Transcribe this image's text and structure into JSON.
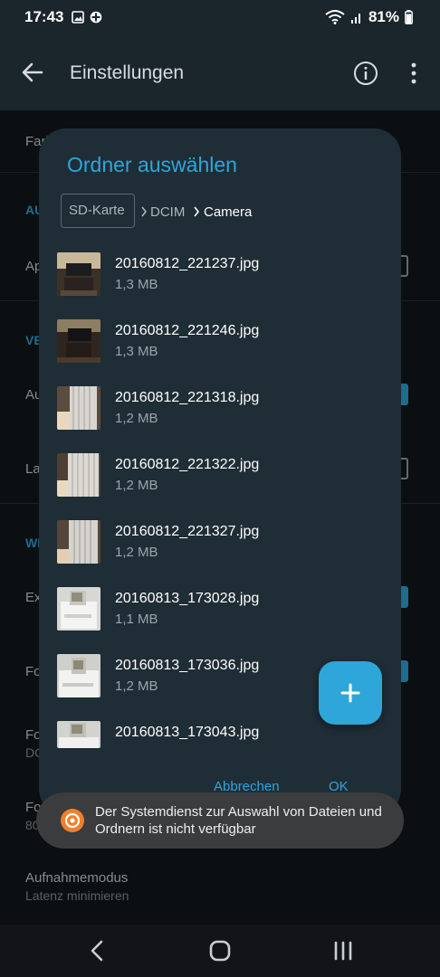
{
  "status_bar": {
    "time": "17:43",
    "battery": "81%"
  },
  "app_bar": {
    "title": "Einstellungen"
  },
  "settings_background": {
    "rows": [
      {
        "label": "Farb"
      },
      {
        "label": "AU"
      },
      {
        "label": "Ap"
      },
      {
        "label": "VE"
      },
      {
        "label": "Au"
      },
      {
        "label": "La"
      },
      {
        "label": "WI"
      },
      {
        "label": "Ex"
      },
      {
        "label": "Fo"
      },
      {
        "label": "Fo"
      },
      {
        "label": "DC"
      },
      {
        "label": "Fo"
      },
      {
        "label": "80"
      }
    ],
    "capture_mode": {
      "label": "Aufnahmemodus",
      "value": "Latenz minimieren"
    }
  },
  "dialog": {
    "title": "Ordner auswählen",
    "breadcrumb": [
      {
        "label": "SD-Karte"
      },
      {
        "label": "DCIM"
      },
      {
        "label": "Camera"
      }
    ],
    "files": [
      {
        "name": "20160812_221237.jpg",
        "size": "1,3 MB",
        "thumb": "tv-room-thumbnail"
      },
      {
        "name": "20160812_221246.jpg",
        "size": "1,3 MB",
        "thumb": "tv-room-thumbnail"
      },
      {
        "name": "20160812_221318.jpg",
        "size": "1,2 MB",
        "thumb": "curtain-thumbnail"
      },
      {
        "name": "20160812_221322.jpg",
        "size": "1,2 MB",
        "thumb": "curtain-thumbnail"
      },
      {
        "name": "20160812_221327.jpg",
        "size": "1,2 MB",
        "thumb": "curtain-thumbnail"
      },
      {
        "name": "20160813_173028.jpg",
        "size": "1,1 MB",
        "thumb": "printer-thumbnail"
      },
      {
        "name": "20160813_173036.jpg",
        "size": "1,2 MB",
        "thumb": "printer-thumbnail"
      },
      {
        "name": "20160813_173043.jpg",
        "size": "",
        "thumb": "printer-thumbnail"
      }
    ],
    "cancel_label": "Abbrechen",
    "ok_label": "OK"
  },
  "toast": {
    "text": "Der Systemdienst zur Auswahl von Dateien und Ordnern ist nicht verfügbar"
  },
  "colors": {
    "accent": "#2ea6da",
    "dialog_bg": "#1f2d36",
    "toast_icon": "#f07f2b"
  }
}
